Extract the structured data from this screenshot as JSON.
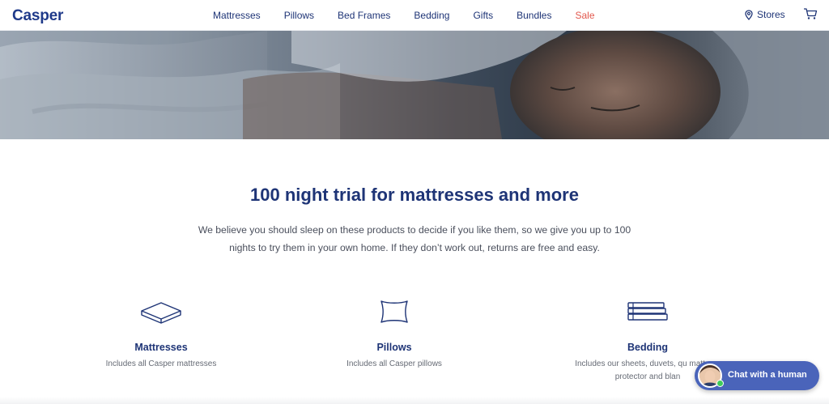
{
  "brand": {
    "logo": "Casper"
  },
  "nav": {
    "links": [
      "Mattresses",
      "Pillows",
      "Bed Frames",
      "Bedding",
      "Gifts",
      "Bundles",
      "Sale"
    ],
    "stores_label": "Stores"
  },
  "hero": {
    "alt": "person-sleeping-image"
  },
  "main": {
    "headline": "100 night trial for mattresses and more",
    "intro": "We believe you should sleep on these products to decide if you like them, so we give you up to 100 nights to try them in your own home. If they don’t work out, returns are free and easy."
  },
  "features": [
    {
      "icon": "mattress-icon",
      "title": "Mattresses",
      "desc": "Includes all Casper mattresses"
    },
    {
      "icon": "pillow-icon",
      "title": "Pillows",
      "desc": "Includes all Casper pillows"
    },
    {
      "icon": "bedding-stack-icon",
      "title": "Bedding",
      "desc": "Includes our sheets, duvets, qu mattress protector and blan"
    }
  ],
  "chat": {
    "label": "Chat with a human"
  },
  "colors": {
    "brand": "#1e3476",
    "sale": "#e2574c",
    "chat": "#4a64ba",
    "online": "#3ecb5a"
  }
}
